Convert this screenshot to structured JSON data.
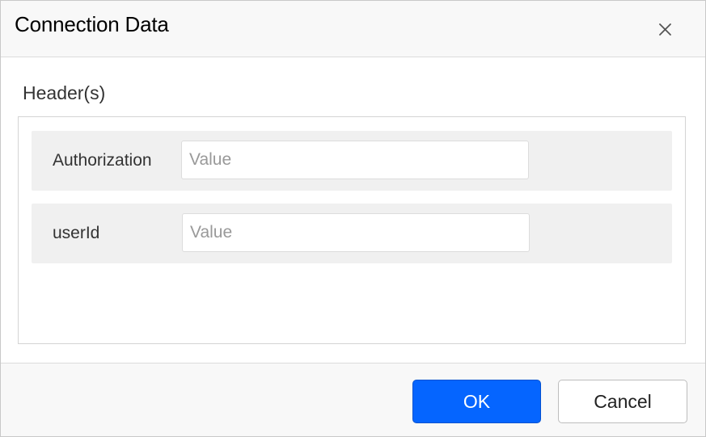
{
  "dialog": {
    "title": "Connection Data",
    "close_icon": "close-icon"
  },
  "headers_section": {
    "label": "Header(s)",
    "rows": [
      {
        "name": "Authorization",
        "value": "",
        "placeholder": "Value"
      },
      {
        "name": "userId",
        "value": "",
        "placeholder": "Value"
      }
    ]
  },
  "footer": {
    "ok_label": "OK",
    "cancel_label": "Cancel"
  },
  "colors": {
    "primary": "#0565ff",
    "header_bg": "#f8f8f8",
    "row_bg": "#f0f0f0"
  }
}
